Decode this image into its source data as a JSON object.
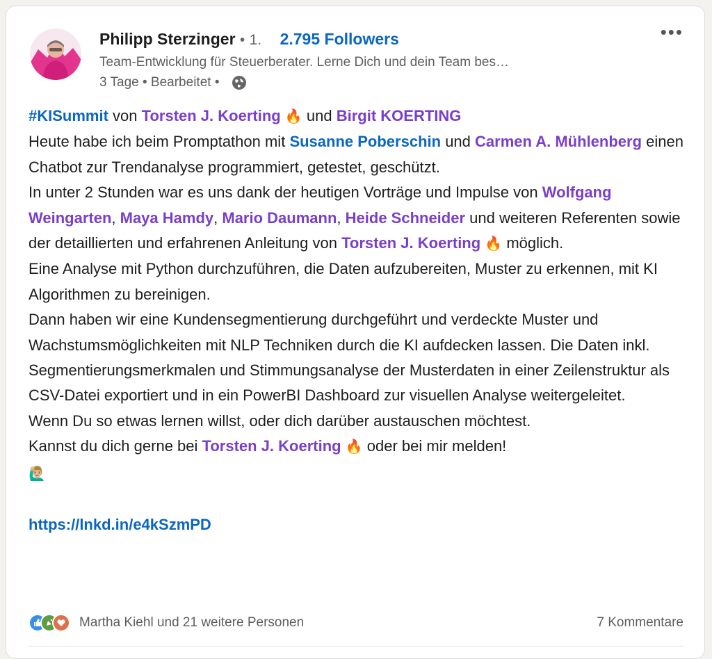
{
  "author": {
    "name": "Philipp Sterzinger",
    "separator": "•",
    "degree": "1.",
    "followers": "2.795 Followers",
    "headline": "Team-Entwicklung für Steuerberater. Lerne Dich und dein Team bes…",
    "time": "3 Tage",
    "edited": "Bearbeitet",
    "meta_separator": "•"
  },
  "post": {
    "hashtag": "#KISummit",
    "w_von": "von",
    "m_torsten": "Torsten J. Koerting",
    "w_und": "und",
    "m_birgit": "Birgit KOERTING",
    "t_heute": "Heute habe ich beim Promptathon mit",
    "m_susanne": "Susanne Poberschin",
    "w_und2": "und",
    "m_carmen": "Carmen A. Mühlenberg",
    "t_chatbot": "einen Chatbot zur Trendanalyse programmiert, getestet, geschützt.",
    "t_unter": "In unter 2 Stunden war es uns dank der heutigen Vorträge und Impulse von",
    "m_wolfgang": "Wolfgang Weingarten",
    "m_maya": "Maya Hamdy",
    "m_mario": "Mario Daumann",
    "m_heide": "Heide Schneider",
    "t_weiteren": "und weiteren Referenten sowie der detaillierten und erfahrenen Anleitung von",
    "m_torsten2": "Torsten J. Koerting",
    "t_moeglich": "möglich.",
    "t_analyse": "Eine Analyse mit Python durchzuführen, die Daten aufzubereiten, Muster zu erkennen, mit KI Algorithmen zu bereinigen.",
    "t_dann": "Dann haben wir eine Kundensegmentierung durchgeführt und verdeckte Muster und Wachstumsmöglichkeiten mit NLP Techniken durch die KI aufdecken lassen. Die Daten inkl. Segmentierungsmerkmalen und Stimmungsanalyse der Musterdaten in einer Zeilenstruktur als CSV-Datei exportiert und in ein PowerBI Dashboard zur visuellen Analyse weitergeleitet.",
    "t_wenn": "Wenn Du so etwas lernen willst, oder dich darüber austauschen möchtest.",
    "t_kannst": "Kannst du dich gerne bei",
    "m_torsten3": "Torsten J. Koerting",
    "t_oder": "oder bei mir melden!",
    "link": "https://lnkd.in/e4kSzmPD"
  },
  "social": {
    "reactions_text": "Martha Kiehl und 21 weitere Personen",
    "comments": "7 Kommentare"
  },
  "icons": {
    "more": "more-options-icon",
    "globe": "globe-icon",
    "fire": "fire-emoji",
    "hand": "raising-hand-emoji",
    "reactions": [
      "like-icon",
      "celebrate-icon",
      "love-icon"
    ]
  },
  "colors": {
    "mention": "#7a3fc9",
    "link": "#0a66c2",
    "like": "#378fe9",
    "celebrate": "#5f9b41",
    "love": "#df704d"
  }
}
